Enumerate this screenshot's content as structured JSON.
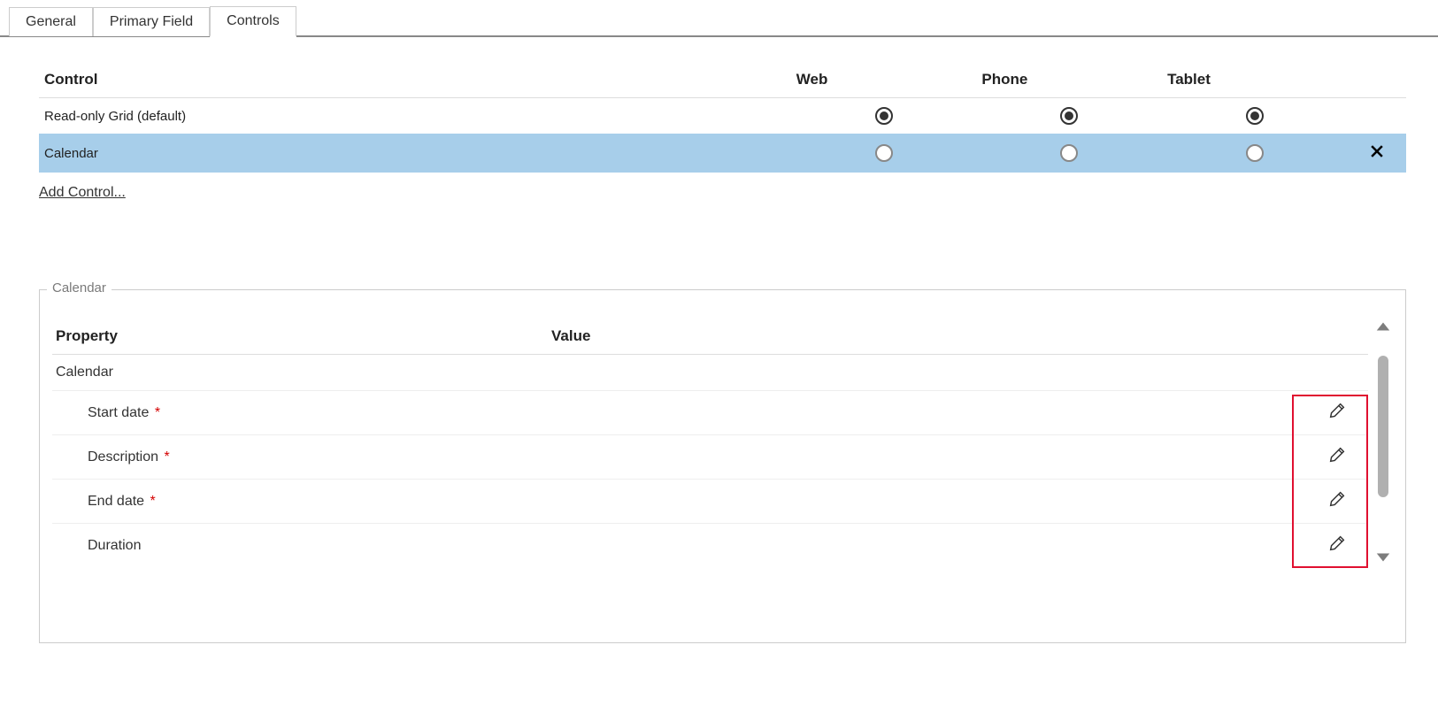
{
  "tabs": [
    {
      "label": "General",
      "active": false
    },
    {
      "label": "Primary Field",
      "active": false
    },
    {
      "label": "Controls",
      "active": true
    }
  ],
  "controls": {
    "headers": {
      "control": "Control",
      "web": "Web",
      "phone": "Phone",
      "tablet": "Tablet"
    },
    "rows": [
      {
        "name": "Read-only Grid (default)",
        "web": true,
        "phone": true,
        "tablet": true,
        "selected": false,
        "removable": false
      },
      {
        "name": "Calendar",
        "web": false,
        "phone": false,
        "tablet": false,
        "selected": true,
        "removable": true
      }
    ],
    "add_label": "Add Control..."
  },
  "property_group": {
    "legend": "Calendar",
    "headers": {
      "property": "Property",
      "value": "Value"
    },
    "rows": [
      {
        "label": "Calendar",
        "indent": false,
        "required": false,
        "editable": false
      },
      {
        "label": "Start date",
        "indent": true,
        "required": true,
        "editable": true
      },
      {
        "label": "Description",
        "indent": true,
        "required": true,
        "editable": true
      },
      {
        "label": "End date",
        "indent": true,
        "required": true,
        "editable": true
      },
      {
        "label": "Duration",
        "indent": true,
        "required": false,
        "editable": true
      }
    ]
  }
}
